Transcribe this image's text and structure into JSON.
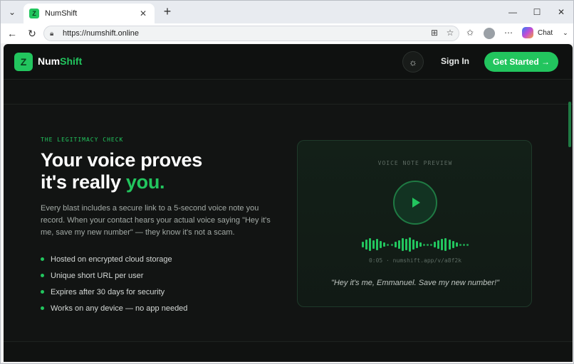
{
  "browser": {
    "tab": {
      "favicon": "Z",
      "title": "NumShift"
    },
    "url": "https://numshift.online",
    "chat_label": "Chat"
  },
  "header": {
    "logo_mark": "Z",
    "logo_primary": "Num",
    "logo_accent": "Shift",
    "sign_in": "Sign In",
    "cta": "Get Started →"
  },
  "hero": {
    "eyebrow": "THE LEGITIMACY CHECK",
    "headline_line1": "Your voice proves",
    "headline_line2_prefix": "it's really ",
    "headline_accent": "you.",
    "body": "Every blast includes a secure link to a 5-second voice note you record. When your contact hears your actual voice saying \"Hey it's me, save my new number\" — they know it's not a scam.",
    "bullets": [
      "Hosted on encrypted cloud storage",
      "Unique short URL per user",
      "Expires after 30 days for security",
      "Works on any device — no app needed"
    ]
  },
  "preview": {
    "label": "VOICE NOTE PREVIEW",
    "meta": "0:05 · numshift.app/v/a8f2k",
    "quote": "\"Hey it's me, Emmanuel. Save my new number!\""
  },
  "colors": {
    "accent": "#22c55e",
    "background": "#0f1110"
  }
}
